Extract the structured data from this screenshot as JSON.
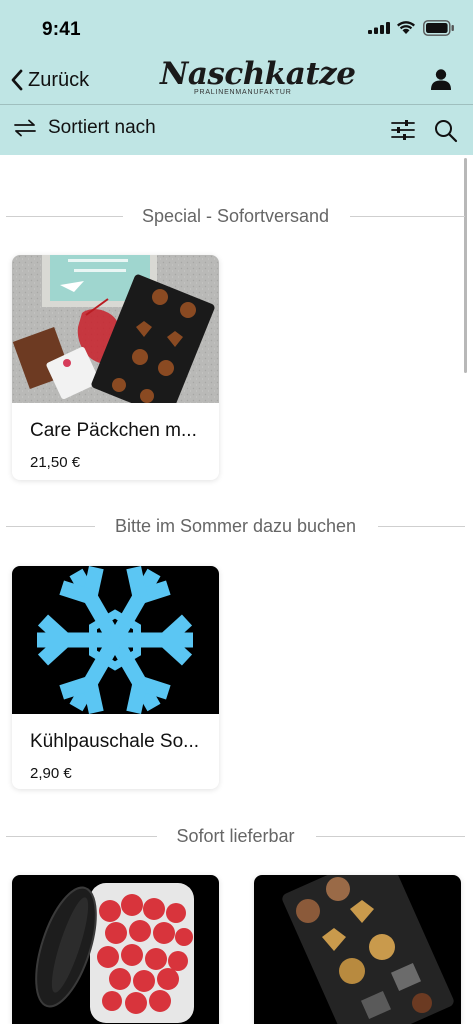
{
  "status": {
    "time": "9:41"
  },
  "nav": {
    "back_label": "Zurück",
    "logo_title": "Naschkatze",
    "logo_subtitle": "PRALINENMANUFAKTUR"
  },
  "toolbar": {
    "sort_label": "Sortiert nach"
  },
  "sections": [
    {
      "title": "Special - Sofortversand",
      "products": [
        {
          "name": "Care Päckchen m...",
          "price": "21,50 €"
        }
      ]
    },
    {
      "title": "Bitte im Sommer dazu buchen",
      "products": [
        {
          "name": "Kühlpauschale So...",
          "price": "2,90 €"
        }
      ]
    },
    {
      "title": "Sofort lieferbar",
      "products": [
        {
          "name": "",
          "price": ""
        },
        {
          "name": "",
          "price": ""
        }
      ]
    }
  ],
  "colors": {
    "header_bg": "#bfe5e4",
    "snowflake": "#5bc6f3"
  }
}
